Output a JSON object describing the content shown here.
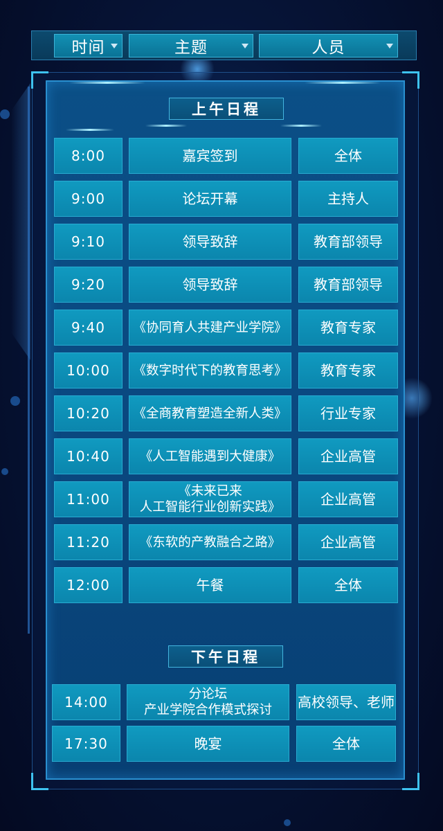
{
  "header": {
    "time_label": "时间",
    "topic_label": "主题",
    "people_label": "人员"
  },
  "morning": {
    "title": "上午日程",
    "rows": [
      {
        "time": "8:00",
        "topic": "嘉宾签到",
        "people": "全体"
      },
      {
        "time": "9:00",
        "topic": "论坛开幕",
        "people": "主持人"
      },
      {
        "time": "9:10",
        "topic": "领导致辞",
        "people": "教育部领导"
      },
      {
        "time": "9:20",
        "topic": "领导致辞",
        "people": "教育部领导"
      },
      {
        "time": "9:40",
        "topic": "《协同育人共建产业学院》",
        "people": "教育专家"
      },
      {
        "time": "10:00",
        "topic": "《数字时代下的教育思考》",
        "people": "教育专家"
      },
      {
        "time": "10:20",
        "topic": "《全商教育塑造全新人类》",
        "people": "行业专家"
      },
      {
        "time": "10:40",
        "topic": "《人工智能遇到大健康》",
        "people": "企业高管"
      },
      {
        "time": "11:00",
        "topic": "《未来已来\n人工智能行业创新实践》",
        "people": "企业高管"
      },
      {
        "time": "11:20",
        "topic": "《东软的产教融合之路》",
        "people": "企业高管"
      },
      {
        "time": "12:00",
        "topic": "午餐",
        "people": "全体"
      }
    ]
  },
  "afternoon": {
    "title": "下午日程",
    "rows": [
      {
        "time": "14:00",
        "topic": "分论坛\n产业学院合作模式探讨",
        "people": "高校领导、老师"
      },
      {
        "time": "17:30",
        "topic": "晚宴",
        "people": "全体"
      }
    ]
  }
}
